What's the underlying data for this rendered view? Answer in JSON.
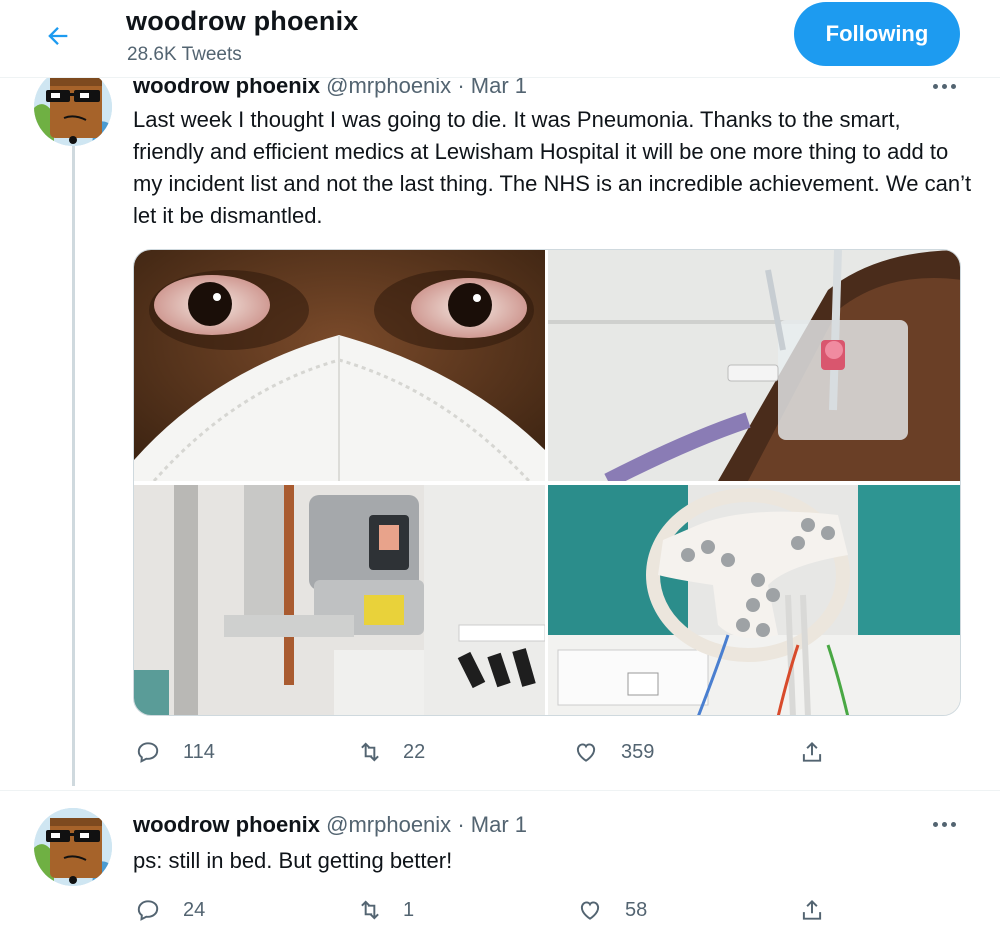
{
  "header": {
    "title": "woodrow phoenix",
    "tweet_count": "28.6K Tweets",
    "follow_label": "Following"
  },
  "colors": {
    "accent": "#1d9bf0",
    "text_primary": "#0f1419",
    "text_secondary": "#536471",
    "thread_line": "#cfd9de"
  },
  "tweets": [
    {
      "name": "woodrow phoenix",
      "handle": "@mrphoenix",
      "separator": "·",
      "date": "Mar 1",
      "text": "Last week I thought I was going to die. It was Pneumonia. Thanks to the smart, friendly and efficient medics at Lewisham Hospital it will be one more thing to add to my incident list and not the last thing. The NHS is an incredible achievement. We can’t let it be dismantled.",
      "replies": "114",
      "retweets": "22",
      "likes": "359"
    },
    {
      "name": "woodrow phoenix",
      "handle": "@mrphoenix",
      "separator": "·",
      "date": "Mar 1",
      "text": "ps: still in bed. But getting better!",
      "replies": "24",
      "retweets": "1",
      "likes": "58"
    }
  ],
  "icons": {
    "back": "arrow-left-icon",
    "more": "more-horizontal-icon",
    "reply": "speech-bubble-icon",
    "retweet": "retweet-arrows-icon",
    "like": "heart-icon",
    "share": "share-upload-icon"
  }
}
